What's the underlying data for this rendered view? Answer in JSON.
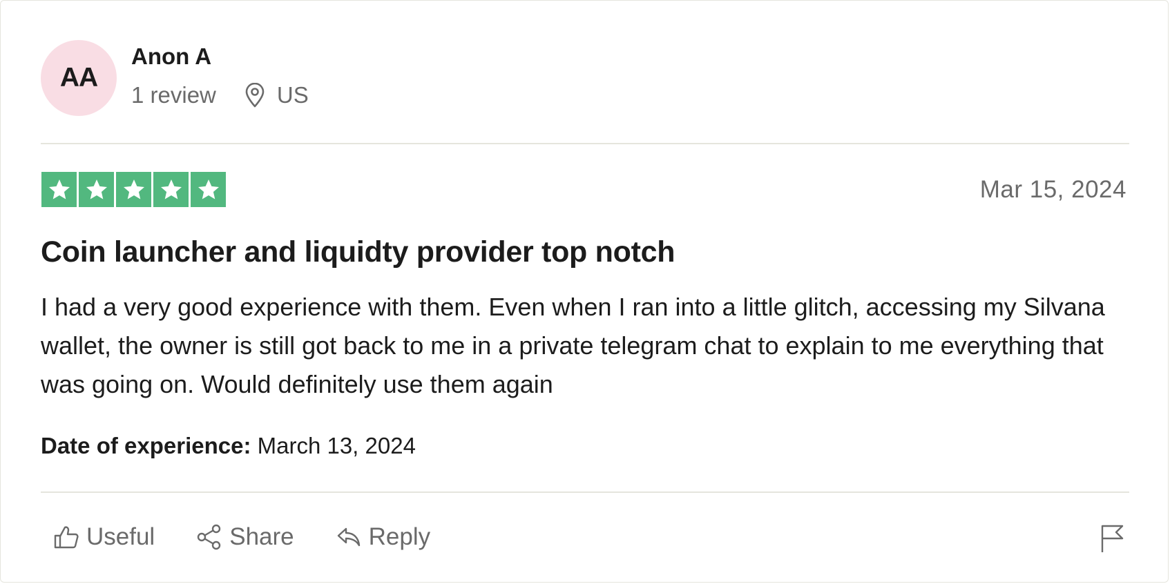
{
  "consumer": {
    "initials": "AA",
    "name": "Anon A",
    "review_count": "1 review",
    "location": "US",
    "avatar_color": "#f9dde4"
  },
  "review": {
    "rating": 5,
    "rating_max": 5,
    "star_color": "#52b87f",
    "date": "Mar 15, 2024",
    "title": "Coin launcher and liquidty provider top notch",
    "body": "I had a very good experience with them. Even when I ran into a little glitch, accessing my Silvana wallet, the owner is still got back to me in a private telegram chat to explain to me everything that was going on. Would definitely use them again",
    "experience_label": "Date of experience:",
    "experience_date": "March 13, 2024"
  },
  "actions": {
    "useful_label": "Useful",
    "share_label": "Share",
    "reply_label": "Reply"
  },
  "icons": {
    "location": "location-pin-icon",
    "useful": "thumbs-up-icon",
    "share": "share-icon",
    "reply": "reply-icon",
    "report": "flag-icon",
    "star": "star-icon"
  }
}
